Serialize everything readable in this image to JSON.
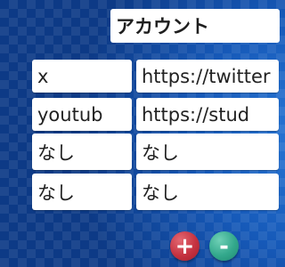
{
  "header": {
    "title": "アカウント"
  },
  "accounts": [
    {
      "service": "x",
      "url": "https://twitter"
    },
    {
      "service": "youtub",
      "url": "https://stud"
    },
    {
      "service": "なし",
      "url": "なし"
    },
    {
      "service": "なし",
      "url": "なし"
    }
  ],
  "controls": {
    "add_label": "+",
    "remove_label": "-"
  },
  "colors": {
    "background": "#0d3a86",
    "add_button": "#c53240",
    "remove_button": "#33a88c"
  }
}
